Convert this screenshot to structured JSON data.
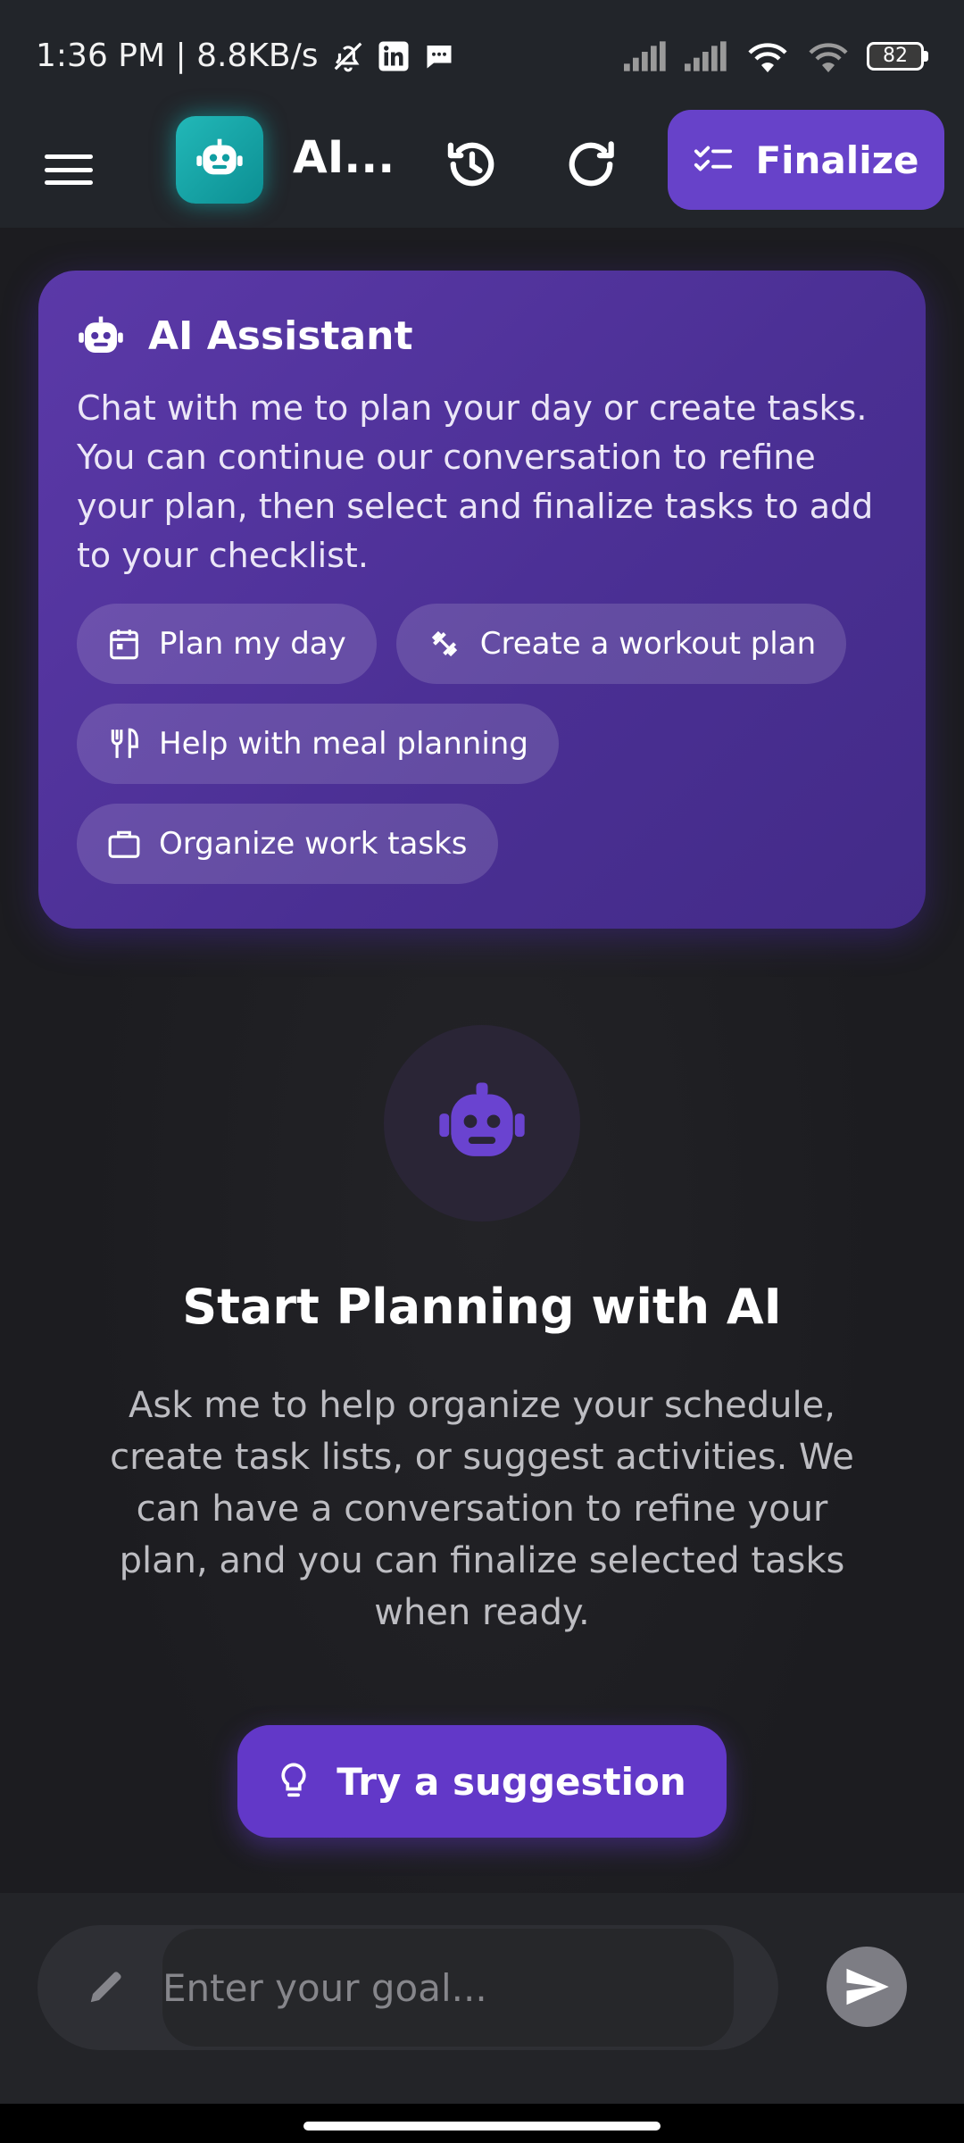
{
  "status": {
    "time_speed": "1:36 PM | 8.8KB/s",
    "battery": "82"
  },
  "app_bar": {
    "title": "AI...",
    "finalize_label": "Finalize"
  },
  "assistant_card": {
    "title": "AI Assistant",
    "description": "Chat with me to plan your day or create tasks. You can continue our conversation to refine your plan, then select and finalize tasks to add to your checklist.",
    "chips": [
      {
        "label": "Plan my day",
        "icon": "calendar-icon"
      },
      {
        "label": "Create a workout plan",
        "icon": "dumbbell-icon"
      },
      {
        "label": "Help with meal planning",
        "icon": "utensils-icon"
      },
      {
        "label": "Organize work tasks",
        "icon": "briefcase-icon"
      }
    ]
  },
  "empty_state": {
    "title": "Start Planning with AI",
    "description": "Ask me to help organize your schedule, create task lists, or suggest activities. We can have a conversation to refine your plan, and you can finalize selected tasks when ready.",
    "suggestion_label": "Try a suggestion"
  },
  "composer": {
    "placeholder": "Enter your goal..."
  },
  "colors": {
    "accent": "#6742c9",
    "logo_teal": "#14a9ad",
    "card_bg": "#4a2f93"
  }
}
